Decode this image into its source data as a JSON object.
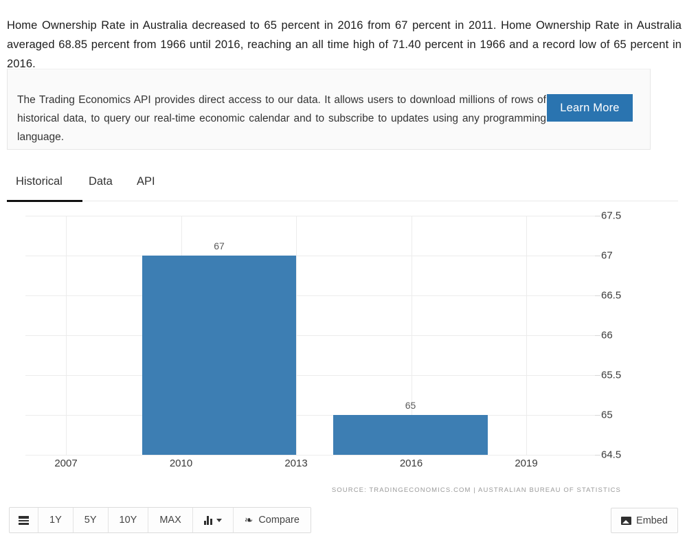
{
  "intro": {
    "text": "Home Ownership Rate in Australia decreased to 65 percent in 2016 from 67 percent in 2011. Home Ownership Rate in Australia averaged 68.85 percent from 1966 until 2016, reaching an all time high of 71.40 percent in 1966 and a record low of 65 percent in 2016."
  },
  "promo": {
    "text": "The Trading Economics API provides direct access to our data. It allows users to download millions of rows of historical data, to query our real-time economic calendar and to subscribe to updates using any programming language.",
    "button_label": "Learn More",
    "button_color": "#2a74b0"
  },
  "tabs": {
    "items": [
      {
        "label": "Historical",
        "active": true
      },
      {
        "label": "Data",
        "active": false
      },
      {
        "label": "API",
        "active": false
      }
    ]
  },
  "chart_data": {
    "type": "bar",
    "title": "",
    "xlabel": "",
    "ylabel": "",
    "categories": [
      "2011",
      "2016"
    ],
    "values": [
      67,
      65
    ],
    "bar_labels": [
      "67",
      "65"
    ],
    "bar_color": "#3d7eb3",
    "grid": true,
    "legend": null,
    "ylim": [
      64.5,
      67.5
    ],
    "yticks": [
      "67.5",
      "67",
      "66.5",
      "66",
      "65.5",
      "65",
      "64.5"
    ],
    "ytick_values": [
      67.5,
      67,
      66.5,
      66,
      65.5,
      65,
      64.5
    ],
    "xticks": [
      "2007",
      "2010",
      "2013",
      "2016",
      "2019"
    ],
    "xtick_values": [
      2007,
      2010,
      2013,
      2016,
      2019
    ],
    "source": "SOURCE: TRADINGECONOMICS.COM | AUSTRALIAN BUREAU OF STATISTICS"
  },
  "toolbar": {
    "menu_icon": "hamburger-menu-icon",
    "ranges": [
      "1Y",
      "5Y",
      "10Y",
      "MAX"
    ],
    "chart_type_icon": "bar-chart-icon",
    "compare_label": "Compare",
    "compare_icon": "shuffle-icon",
    "embed_label": "Embed",
    "embed_icon": "image-icon"
  }
}
